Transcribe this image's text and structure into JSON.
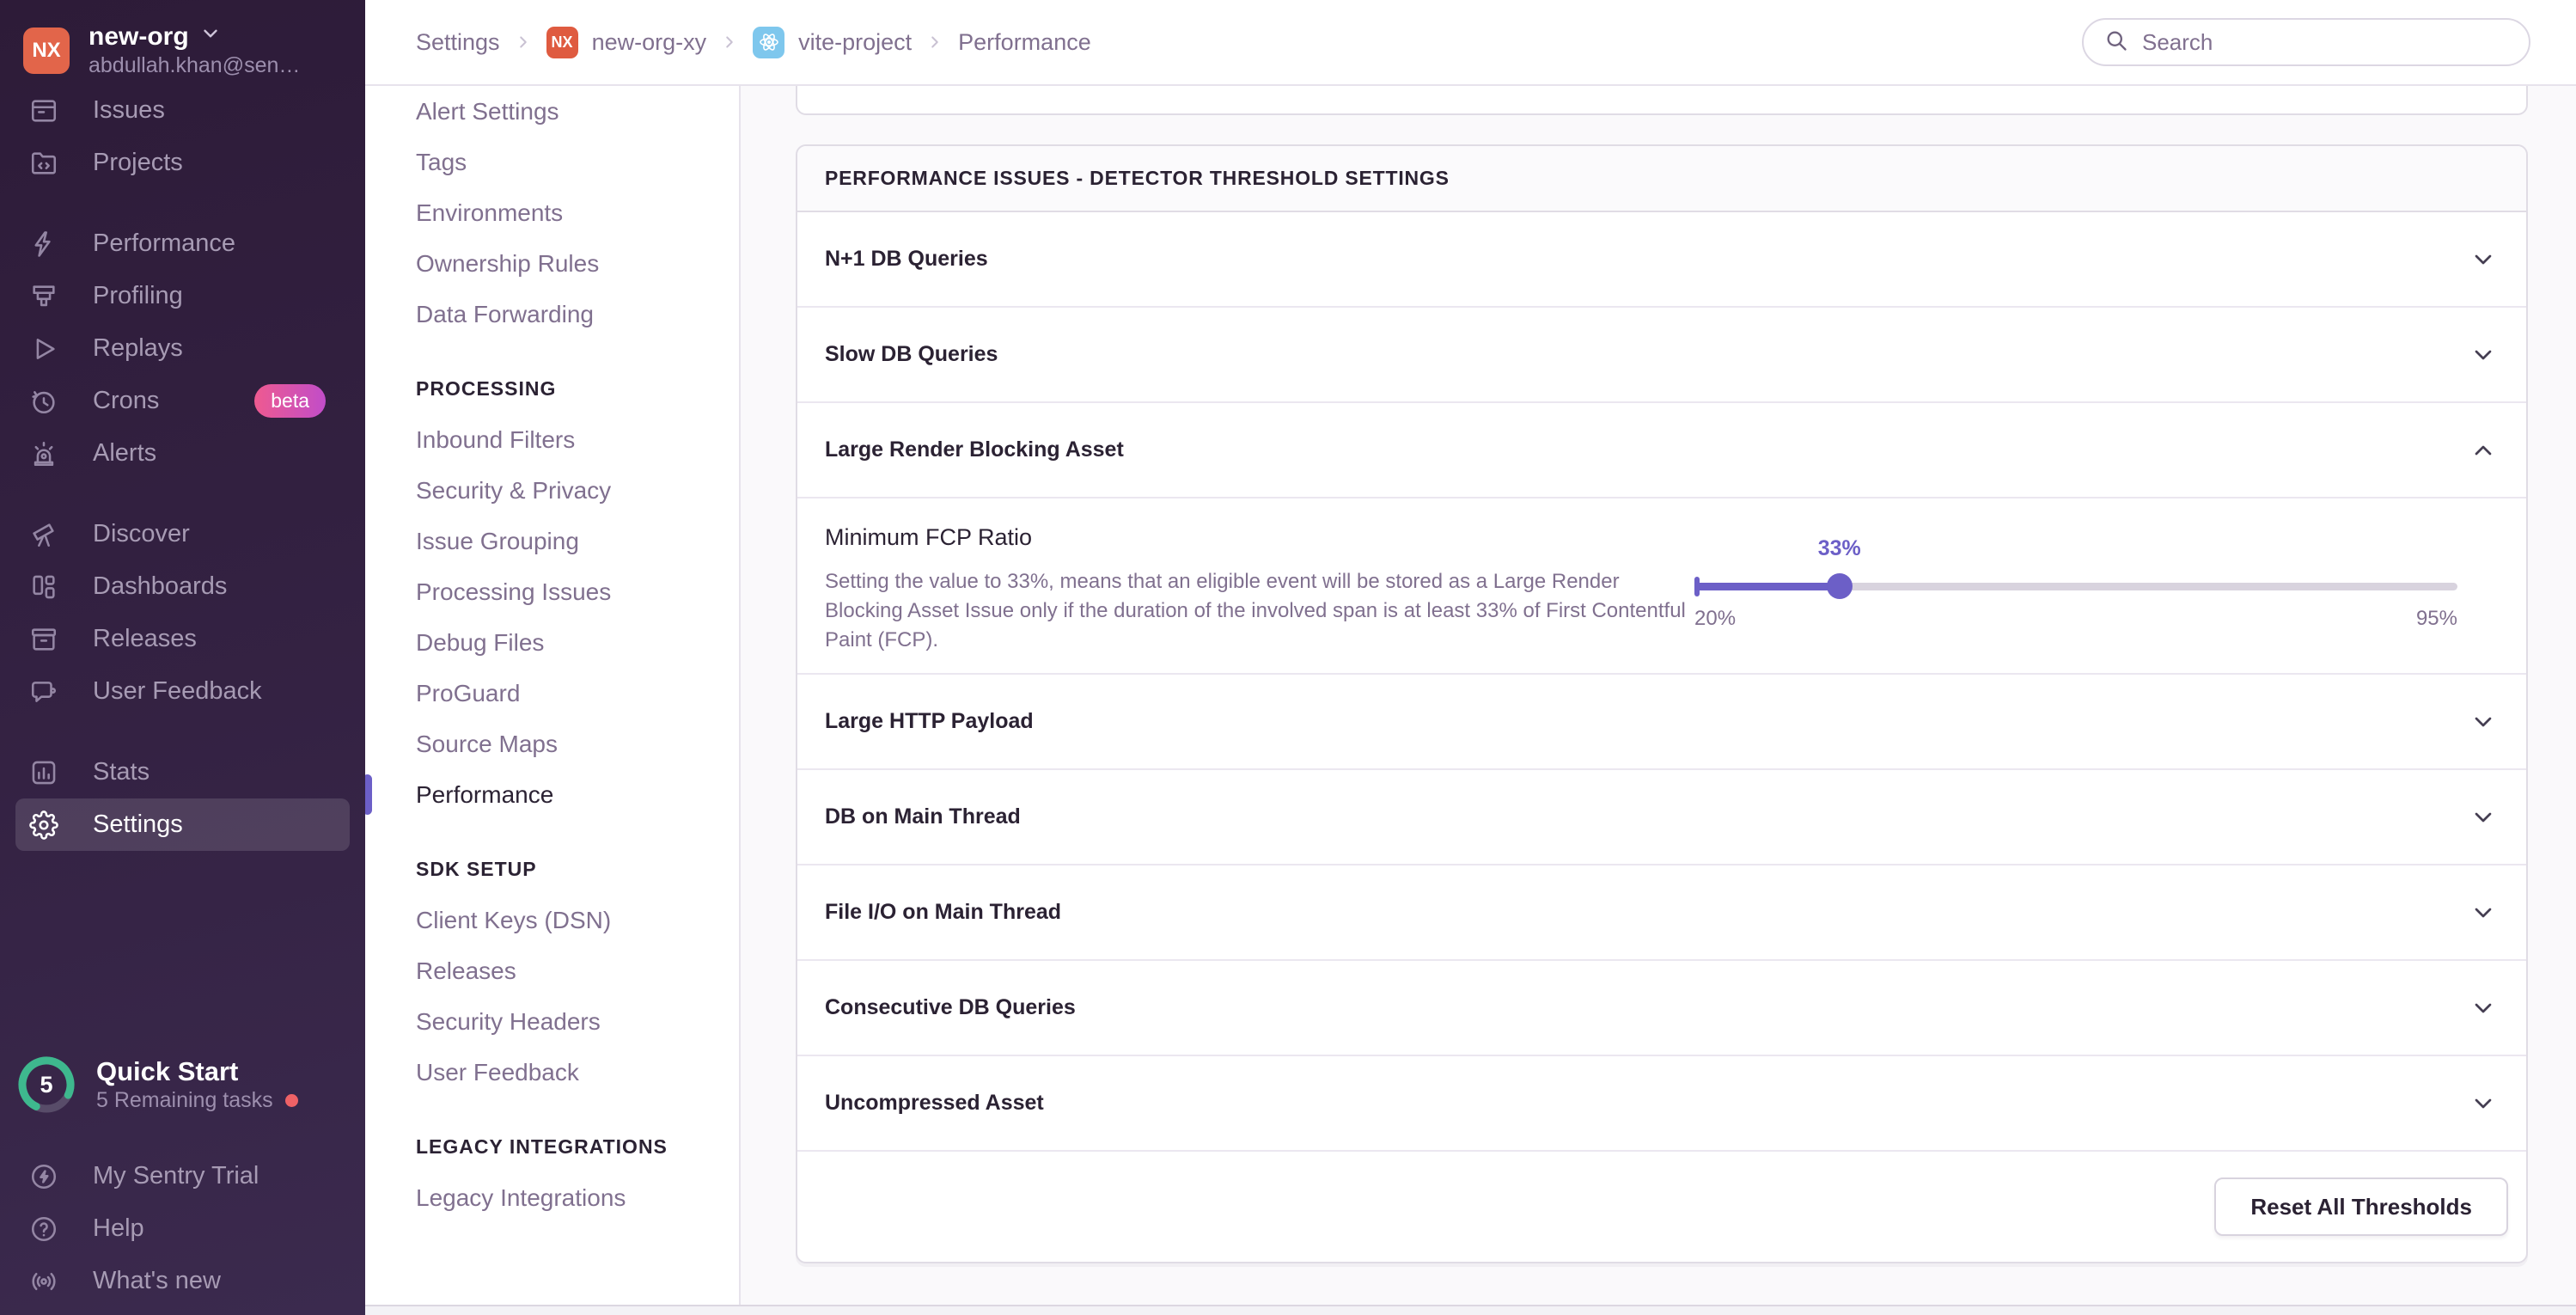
{
  "org": {
    "initials": "NX",
    "name": "new-org",
    "email": "abdullah.khan@sen…"
  },
  "sidebar": {
    "primary": [
      {
        "label": "Issues"
      },
      {
        "label": "Projects"
      },
      {
        "label": "Performance"
      },
      {
        "label": "Profiling"
      },
      {
        "label": "Replays"
      },
      {
        "label": "Crons",
        "badge": "beta"
      },
      {
        "label": "Alerts"
      },
      {
        "label": "Discover"
      },
      {
        "label": "Dashboards"
      },
      {
        "label": "Releases"
      },
      {
        "label": "User Feedback"
      },
      {
        "label": "Stats"
      },
      {
        "label": "Settings"
      }
    ],
    "quick_start": {
      "count": "5",
      "title": "Quick Start",
      "subtitle": "5 Remaining tasks"
    },
    "footer": [
      {
        "label": "My Sentry Trial"
      },
      {
        "label": "Help"
      },
      {
        "label": "What's new"
      }
    ]
  },
  "topbar": {
    "breadcrumb": [
      {
        "label": "Settings"
      },
      {
        "label": "new-org-xy",
        "badge": "NX"
      },
      {
        "label": "vite-project"
      },
      {
        "label": "Performance"
      }
    ],
    "search_placeholder": "Search"
  },
  "settings_nav": {
    "groups": [
      {
        "header": "",
        "items": [
          "Alert Settings",
          "Tags",
          "Environments",
          "Ownership Rules",
          "Data Forwarding"
        ]
      },
      {
        "header": "PROCESSING",
        "items": [
          "Inbound Filters",
          "Security & Privacy",
          "Issue Grouping",
          "Processing Issues",
          "Debug Files",
          "ProGuard",
          "Source Maps",
          "Performance"
        ]
      },
      {
        "header": "SDK SETUP",
        "items": [
          "Client Keys (DSN)",
          "Releases",
          "Security Headers",
          "User Feedback"
        ]
      },
      {
        "header": "LEGACY INTEGRATIONS",
        "items": [
          "Legacy Integrations"
        ]
      }
    ],
    "active_item": "Performance"
  },
  "panel": {
    "title": "PERFORMANCE ISSUES - DETECTOR THRESHOLD SETTINGS",
    "rows": [
      "N+1 DB Queries",
      "Slow DB Queries",
      "Large Render Blocking Asset",
      "Large HTTP Payload",
      "DB on Main Thread",
      "File I/O on Main Thread",
      "Consecutive DB Queries",
      "Uncompressed Asset"
    ],
    "expanded_row": "Large Render Blocking Asset",
    "detail": {
      "title": "Minimum FCP Ratio",
      "description": "Setting the value to 33%, means that an eligible event will be stored as a Large Render Blocking Asset Issue only if the duration of the involved span is at least 33% of First Contentful Paint (FCP).",
      "slider": {
        "value": "33%",
        "min": "20%",
        "max": "95%",
        "percent": 19
      }
    },
    "footer": {
      "reset_label": "Reset All Thresholds"
    }
  },
  "colors": {
    "accent": "#6c5fc7",
    "org_avatar": "#e2654a",
    "beta_gradient": "#ee5a90 → #c14dc9",
    "react_badge": "#7ec7ed"
  }
}
